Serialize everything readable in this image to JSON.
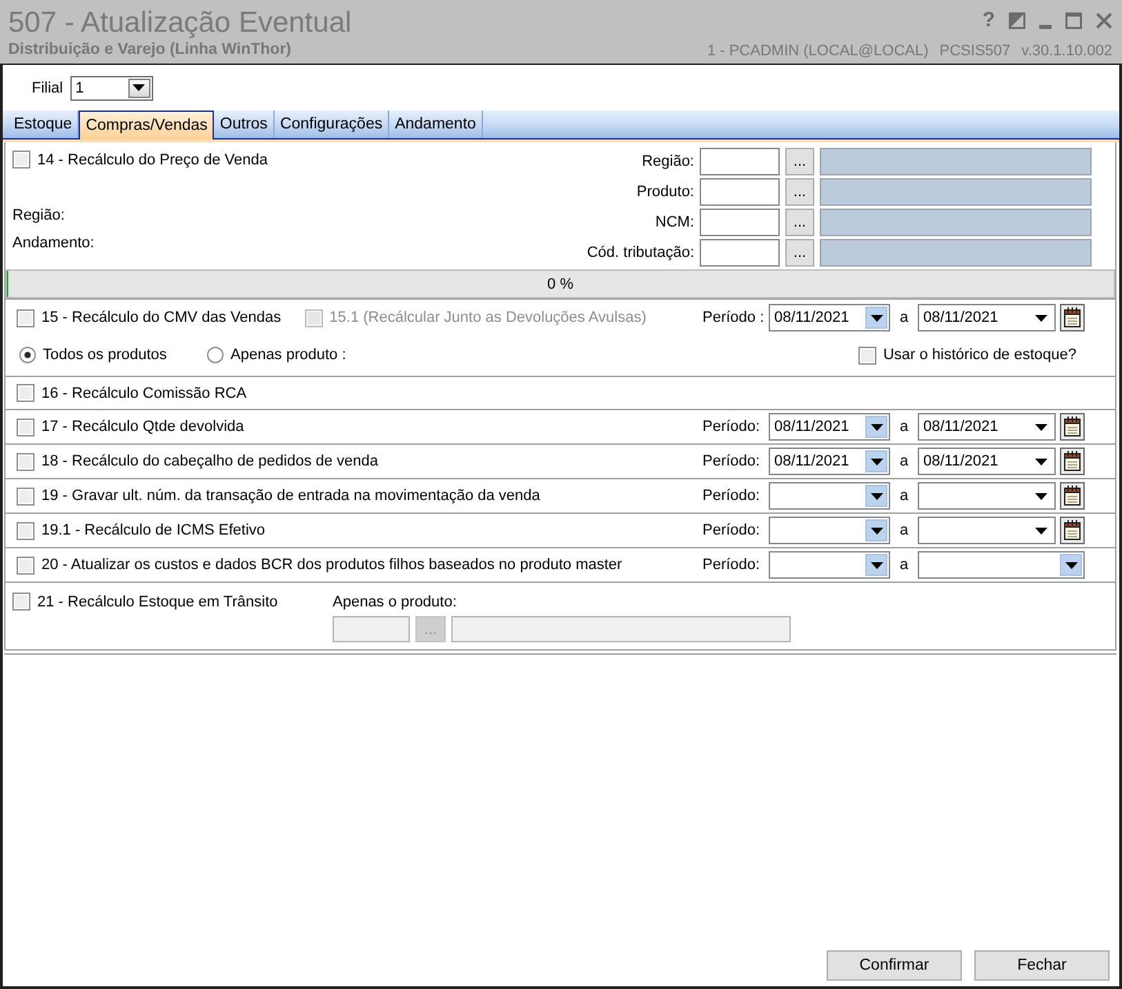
{
  "window": {
    "title": "507 - Atualização Eventual",
    "subtitle": "Distribuição e Varejo (Linha WinThor)",
    "help": "?",
    "user": "1 - PCADMIN (LOCAL@LOCAL)",
    "program": "PCSIS507",
    "version": "v.30.1.10.002"
  },
  "filial": {
    "label": "Filial",
    "value": "1"
  },
  "tabs": [
    {
      "label": "Estoque",
      "selected": false
    },
    {
      "label": "Compras/Vendas",
      "selected": true
    },
    {
      "label": "Outros",
      "selected": false
    },
    {
      "label": "Configurações",
      "selected": false
    },
    {
      "label": "Andamento",
      "selected": false
    }
  ],
  "sections": [
    {
      "kind": "lookup",
      "checkbox": {
        "label": "14 - Recálculo do Preço de Venda",
        "checked": false
      },
      "status_labels": [
        "Região:",
        "Andamento:"
      ],
      "fields": [
        {
          "label": "Região:",
          "button": "..."
        },
        {
          "label": "Produto:",
          "button": "..."
        },
        {
          "label": "NCM:",
          "button": "..."
        },
        {
          "label": "Cód. tributação:",
          "button": "..."
        }
      ],
      "progress": {
        "text": "0 %",
        "level": 0
      }
    },
    {
      "kind": "cmv",
      "checkbox": {
        "label": "15 - Recálculo do CMV das Vendas",
        "checked": false
      },
      "sub_checkbox": {
        "label": "15.1 (Recálcular Junto as Devoluções Avulsas)",
        "checked": false,
        "disabled": true
      },
      "period": {
        "label": "Período :",
        "from": "08/11/2021",
        "separator": "a",
        "to": "08/11/2021",
        "calendar": true
      },
      "radios": [
        {
          "label": "Todos os produtos",
          "selected": true
        },
        {
          "label": "Apenas produto :",
          "selected": false
        }
      ],
      "extra_checkbox": {
        "label": "Usar o histórico de estoque?",
        "checked": false
      }
    },
    {
      "kind": "simple",
      "checkbox": {
        "label": "16 - Recálculo Comissão RCA",
        "checked": false
      }
    },
    {
      "kind": "period",
      "checkbox": {
        "label": "17 - Recálculo Qtde devolvida",
        "checked": false
      },
      "period": {
        "label": "Período:",
        "from": "08/11/2021",
        "separator": "a",
        "to": "08/11/2021",
        "calendar": true
      }
    },
    {
      "kind": "period",
      "checkbox": {
        "label": "18 - Recálculo do cabeçalho de pedidos de venda",
        "checked": false
      },
      "period": {
        "label": "Período:",
        "from": "08/11/2021",
        "separator": "a",
        "to": "08/11/2021",
        "calendar": true
      }
    },
    {
      "kind": "period",
      "checkbox": {
        "label": "19 - Gravar ult. núm. da transação de entrada na movimentação da venda",
        "checked": false
      },
      "period": {
        "label": "Período:",
        "separator": "a",
        "calendar": true
      }
    },
    {
      "kind": "period",
      "checkbox": {
        "label": "19.1 - Recálculo de ICMS Efetivo",
        "checked": false
      },
      "period": {
        "label": "Período:",
        "separator": "a",
        "calendar": true
      }
    },
    {
      "kind": "period",
      "checkbox": {
        "label": "20 - Atualizar os custos e dados BCR dos produtos filhos baseados no produto master",
        "checked": false
      },
      "period": {
        "label": "Período:",
        "separator": "a",
        "calendar": false
      }
    },
    {
      "kind": "product",
      "checkbox": {
        "label": "21 - Recálculo Estoque em Trânsito",
        "checked": false
      },
      "product": {
        "label": "Apenas o produto:",
        "button": "...",
        "disabled": true
      }
    }
  ],
  "buttons": [
    {
      "label": "Confirmar"
    },
    {
      "label": "Fechar"
    }
  ]
}
